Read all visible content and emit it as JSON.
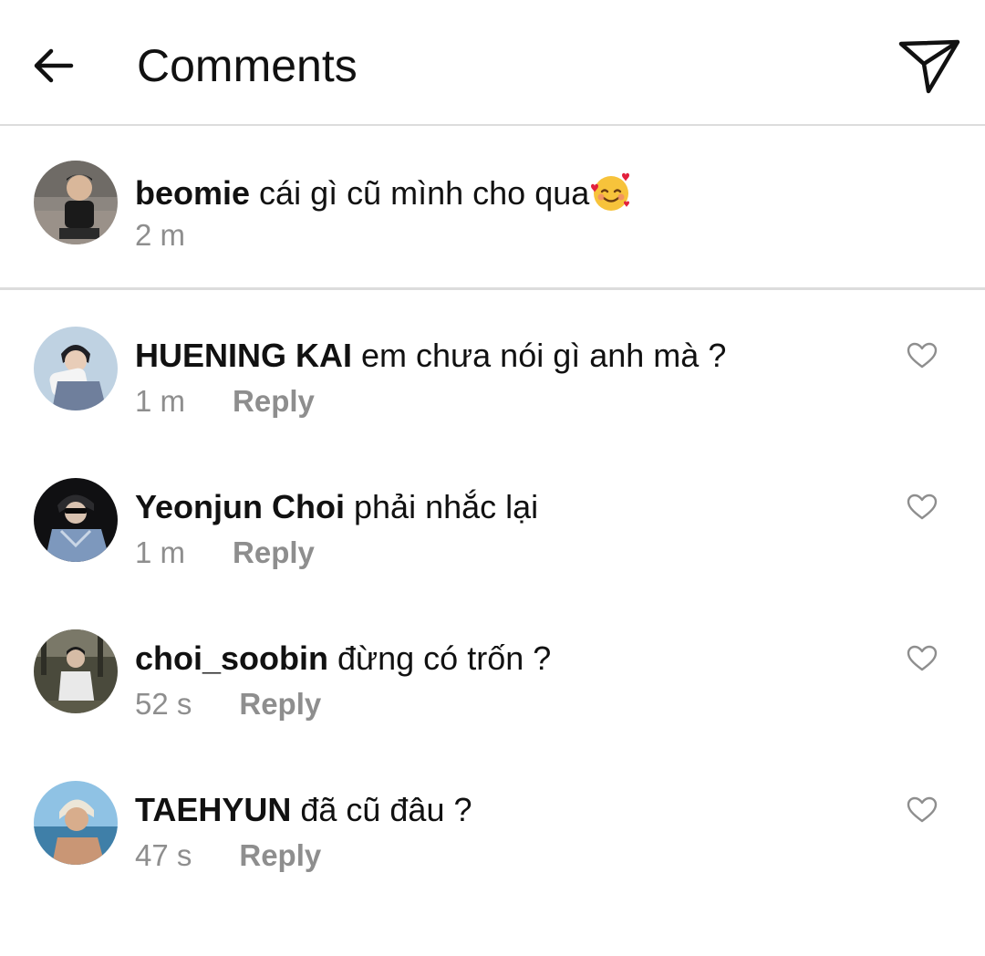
{
  "header": {
    "title": "Comments",
    "back_icon": "arrow-left-icon",
    "send_icon": "paper-plane-icon"
  },
  "caption": {
    "username": "beomie",
    "text": "cái gì cũ mình cho qua",
    "emoji": "smiling-face-with-hearts-emoji",
    "time": "2 m"
  },
  "comments": [
    {
      "username": "HUENING KAI",
      "text": "em chưa nói gì anh mà ?",
      "time": "1 m",
      "reply_label": "Reply"
    },
    {
      "username": "Yeonjun Choi",
      "text": "phải nhắc lại",
      "time": "1 m",
      "reply_label": "Reply"
    },
    {
      "username": "choi_soobin",
      "text": "đừng có trốn ?",
      "time": "52 s",
      "reply_label": "Reply"
    },
    {
      "username": "TAEHYUN",
      "text": "đã cũ đâu ?",
      "time": "47 s",
      "reply_label": "Reply"
    }
  ],
  "colors": {
    "text": "#111111",
    "meta": "#8e8e8e",
    "divider": "#dcdcdc"
  }
}
